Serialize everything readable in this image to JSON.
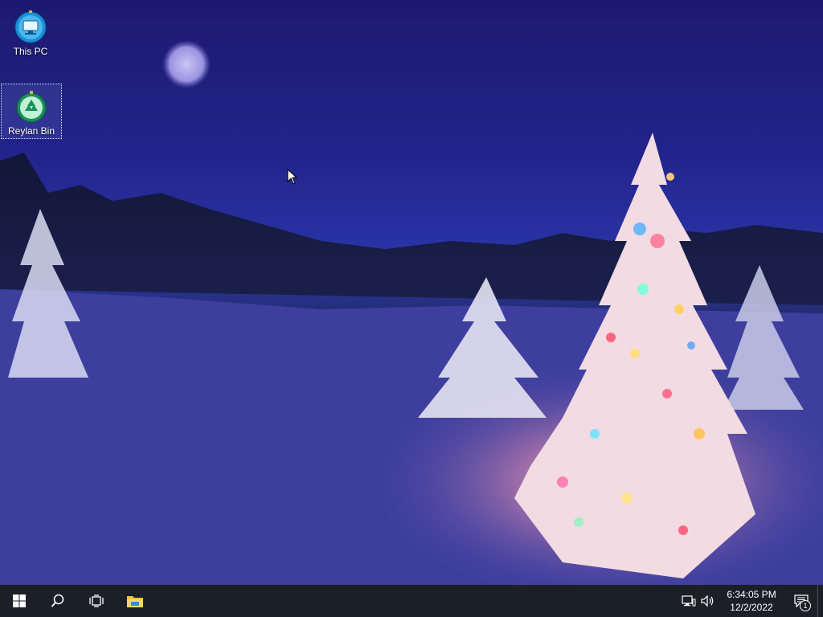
{
  "desktop": {
    "icons": [
      {
        "label": "This PC",
        "icon": "this-pc-icon"
      },
      {
        "label": "Reylan Bin",
        "icon": "recycle-bin-icon"
      }
    ],
    "wallpaper": "snowy-night-christmas-tree"
  },
  "taskbar": {
    "start_icon": "windows-start-icon",
    "search_icon": "search-icon",
    "task_view_icon": "task-view-icon",
    "pinned": [
      {
        "icon": "file-explorer-icon"
      }
    ],
    "tray": {
      "network_icon": "network-icon",
      "volume_icon": "volume-icon",
      "time": "6:34:05 PM",
      "date": "12/2/2022",
      "notification_count": "1"
    }
  },
  "colors": {
    "taskbar_bg": "#1b1f26",
    "accent": "#76b9ed",
    "sky_top": "#1c1a6e",
    "snow": "#4a4aa8"
  }
}
